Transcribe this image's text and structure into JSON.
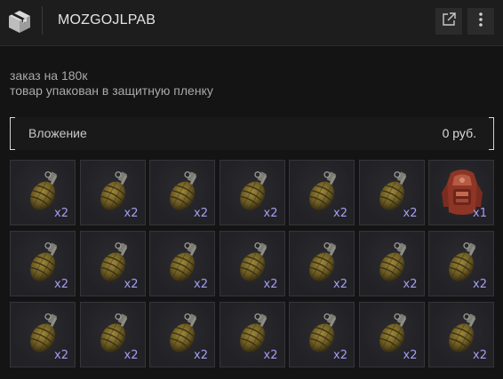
{
  "header": {
    "title": "MOZGOJLPAB",
    "icons": {
      "logo": "package-box-icon",
      "share": "external-link-icon",
      "menu": "vertical-dots-icon"
    }
  },
  "description": {
    "line1": "заказ на 180к",
    "line2": "товар упакован в защитную пленку"
  },
  "attachment": {
    "label": "Вложение",
    "value": "0 руб."
  },
  "items": [
    {
      "icon": "grenade-icon",
      "qty": "x2"
    },
    {
      "icon": "grenade-icon",
      "qty": "x2"
    },
    {
      "icon": "grenade-icon",
      "qty": "x2"
    },
    {
      "icon": "grenade-icon",
      "qty": "x2"
    },
    {
      "icon": "grenade-icon",
      "qty": "x2"
    },
    {
      "icon": "grenade-icon",
      "qty": "x2"
    },
    {
      "icon": "armor-vest-icon",
      "qty": "x1"
    },
    {
      "icon": "grenade-icon",
      "qty": "x2"
    },
    {
      "icon": "grenade-icon",
      "qty": "x2"
    },
    {
      "icon": "grenade-icon",
      "qty": "x2"
    },
    {
      "icon": "grenade-icon",
      "qty": "x2"
    },
    {
      "icon": "grenade-icon",
      "qty": "x2"
    },
    {
      "icon": "grenade-icon",
      "qty": "x2"
    },
    {
      "icon": "grenade-icon",
      "qty": "x2"
    },
    {
      "icon": "grenade-icon",
      "qty": "x2"
    },
    {
      "icon": "grenade-icon",
      "qty": "x2"
    },
    {
      "icon": "grenade-icon",
      "qty": "x2"
    },
    {
      "icon": "grenade-icon",
      "qty": "x2"
    },
    {
      "icon": "grenade-icon",
      "qty": "x2"
    },
    {
      "icon": "grenade-icon",
      "qty": "x2"
    },
    {
      "icon": "grenade-icon",
      "qty": "x2"
    }
  ],
  "colors": {
    "background": "#141414",
    "header": "#1d1d1d",
    "quantity_text": "#a59ef4",
    "slot_bg": "#222226"
  }
}
